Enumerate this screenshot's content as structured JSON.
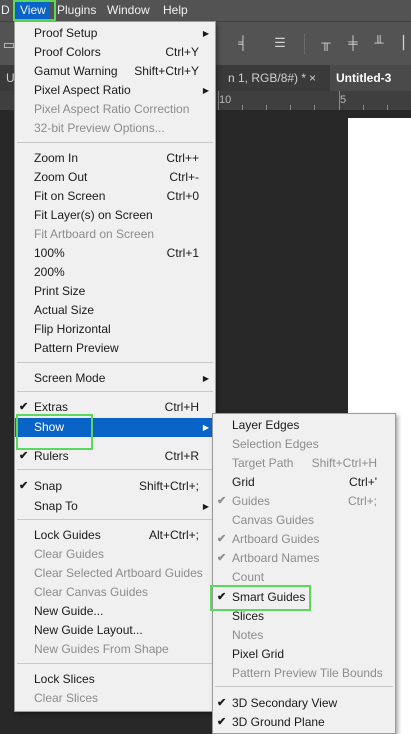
{
  "menubar": {
    "items": [
      "D",
      "View",
      "Plugins",
      "Window",
      "Help"
    ]
  },
  "tabs": {
    "partial_left": "U",
    "doc_tab": "n 1, RGB/8#) *",
    "close_glyph": "×",
    "active_tab": "Untitled-3 @"
  },
  "ruler": {
    "numbers": [
      "10",
      "5"
    ]
  },
  "view_menu": {
    "items": [
      {
        "label": "Proof Setup",
        "shortcut": "",
        "submenu": true,
        "disabled": false,
        "checked": false
      },
      {
        "label": "Proof Colors",
        "shortcut": "Ctrl+Y",
        "submenu": false,
        "disabled": false,
        "checked": false
      },
      {
        "label": "Gamut Warning",
        "shortcut": "Shift+Ctrl+Y",
        "submenu": false,
        "disabled": false,
        "checked": false
      },
      {
        "label": "Pixel Aspect Ratio",
        "shortcut": "",
        "submenu": true,
        "disabled": false,
        "checked": false
      },
      {
        "label": "Pixel Aspect Ratio Correction",
        "shortcut": "",
        "submenu": false,
        "disabled": true,
        "checked": false
      },
      {
        "label": "32-bit Preview Options...",
        "shortcut": "",
        "submenu": false,
        "disabled": true,
        "checked": false
      },
      {
        "label": "Zoom In",
        "shortcut": "Ctrl++",
        "submenu": false,
        "disabled": false,
        "checked": false
      },
      {
        "label": "Zoom Out",
        "shortcut": "Ctrl+-",
        "submenu": false,
        "disabled": false,
        "checked": false
      },
      {
        "label": "Fit on Screen",
        "shortcut": "Ctrl+0",
        "submenu": false,
        "disabled": false,
        "checked": false
      },
      {
        "label": "Fit Layer(s) on Screen",
        "shortcut": "",
        "submenu": false,
        "disabled": false,
        "checked": false
      },
      {
        "label": "Fit Artboard on Screen",
        "shortcut": "",
        "submenu": false,
        "disabled": true,
        "checked": false
      },
      {
        "label": "100%",
        "shortcut": "Ctrl+1",
        "submenu": false,
        "disabled": false,
        "checked": false
      },
      {
        "label": "200%",
        "shortcut": "",
        "submenu": false,
        "disabled": false,
        "checked": false
      },
      {
        "label": "Print Size",
        "shortcut": "",
        "submenu": false,
        "disabled": false,
        "checked": false
      },
      {
        "label": "Actual Size",
        "shortcut": "",
        "submenu": false,
        "disabled": false,
        "checked": false
      },
      {
        "label": "Flip Horizontal",
        "shortcut": "",
        "submenu": false,
        "disabled": false,
        "checked": false
      },
      {
        "label": "Pattern Preview",
        "shortcut": "",
        "submenu": false,
        "disabled": false,
        "checked": false
      },
      {
        "label": "Screen Mode",
        "shortcut": "",
        "submenu": true,
        "disabled": false,
        "checked": false
      },
      {
        "label": "Extras",
        "shortcut": "Ctrl+H",
        "submenu": false,
        "disabled": false,
        "checked": true
      },
      {
        "label": "Show",
        "shortcut": "",
        "submenu": true,
        "disabled": false,
        "checked": false,
        "selected": true
      },
      {
        "label": "Rulers",
        "shortcut": "Ctrl+R",
        "submenu": false,
        "disabled": false,
        "checked": true
      },
      {
        "label": "Snap",
        "shortcut": "Shift+Ctrl+;",
        "submenu": false,
        "disabled": false,
        "checked": true
      },
      {
        "label": "Snap To",
        "shortcut": "",
        "submenu": true,
        "disabled": false,
        "checked": false
      },
      {
        "label": "Lock Guides",
        "shortcut": "Alt+Ctrl+;",
        "submenu": false,
        "disabled": false,
        "checked": false
      },
      {
        "label": "Clear Guides",
        "shortcut": "",
        "submenu": false,
        "disabled": true,
        "checked": false
      },
      {
        "label": "Clear Selected Artboard Guides",
        "shortcut": "",
        "submenu": false,
        "disabled": true,
        "checked": false
      },
      {
        "label": "Clear Canvas Guides",
        "shortcut": "",
        "submenu": false,
        "disabled": true,
        "checked": false
      },
      {
        "label": "New Guide...",
        "shortcut": "",
        "submenu": false,
        "disabled": false,
        "checked": false
      },
      {
        "label": "New Guide Layout...",
        "shortcut": "",
        "submenu": false,
        "disabled": false,
        "checked": false
      },
      {
        "label": "New Guides From Shape",
        "shortcut": "",
        "submenu": false,
        "disabled": true,
        "checked": false
      },
      {
        "label": "Lock Slices",
        "shortcut": "",
        "submenu": false,
        "disabled": false,
        "checked": false
      },
      {
        "label": "Clear Slices",
        "shortcut": "",
        "submenu": false,
        "disabled": true,
        "checked": false
      }
    ]
  },
  "show_menu": {
    "items": [
      {
        "label": "Layer Edges",
        "shortcut": "",
        "disabled": false,
        "checked": false
      },
      {
        "label": "Selection Edges",
        "shortcut": "",
        "disabled": true,
        "checked": false
      },
      {
        "label": "Target Path",
        "shortcut": "Shift+Ctrl+H",
        "disabled": true,
        "checked": false
      },
      {
        "label": "Grid",
        "shortcut": "Ctrl+'",
        "disabled": false,
        "checked": false
      },
      {
        "label": "Guides",
        "shortcut": "Ctrl+;",
        "disabled": true,
        "checked": true
      },
      {
        "label": "Canvas Guides",
        "shortcut": "",
        "disabled": true,
        "checked": false
      },
      {
        "label": "Artboard Guides",
        "shortcut": "",
        "disabled": true,
        "checked": true
      },
      {
        "label": "Artboard Names",
        "shortcut": "",
        "disabled": true,
        "checked": true
      },
      {
        "label": "Count",
        "shortcut": "",
        "disabled": true,
        "checked": false
      },
      {
        "label": "Smart Guides",
        "shortcut": "",
        "disabled": false,
        "checked": true
      },
      {
        "label": "Slices",
        "shortcut": "",
        "disabled": false,
        "checked": false
      },
      {
        "label": "Notes",
        "shortcut": "",
        "disabled": true,
        "checked": false
      },
      {
        "label": "Pixel Grid",
        "shortcut": "",
        "disabled": false,
        "checked": false
      },
      {
        "label": "Pattern Preview Tile Bounds",
        "shortcut": "",
        "disabled": true,
        "checked": false
      },
      {
        "label": "3D Secondary View",
        "shortcut": "",
        "disabled": false,
        "checked": true
      },
      {
        "label": "3D Ground Plane",
        "shortcut": "",
        "disabled": false,
        "checked": true
      }
    ]
  },
  "glyphs": {
    "check": "✔",
    "submenu_arrow": "▶"
  },
  "colors": {
    "highlight": "#0a64c8",
    "callout": "#5bd95b",
    "menu_bg": "#f0f0f0",
    "disabled_text": "#8c8c8c"
  }
}
